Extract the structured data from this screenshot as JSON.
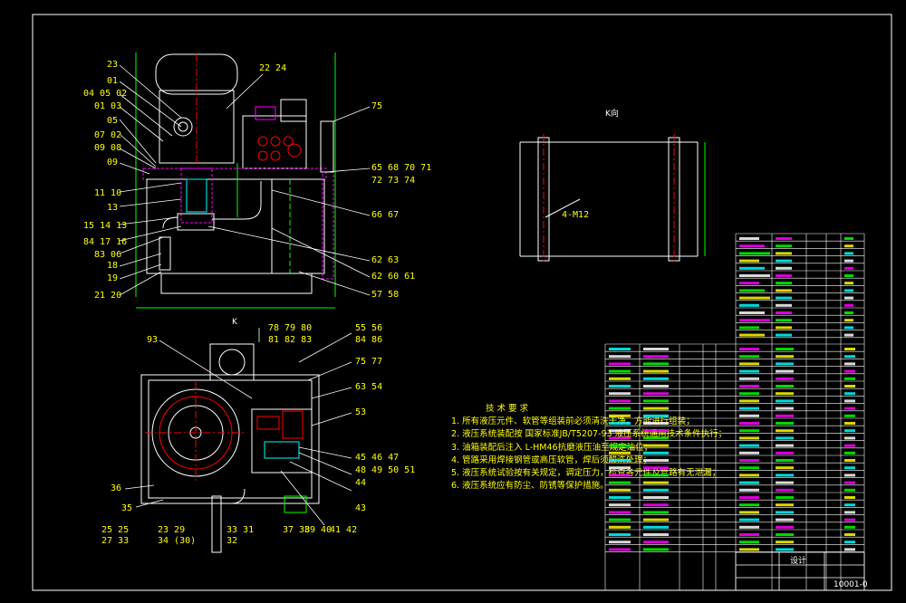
{
  "drawing": {
    "k_label": "K",
    "k_view_title": "K向",
    "bolt_callout": "4-M12",
    "sheet_title": "设计",
    "sheet_id": "10001-0"
  },
  "callouts": {
    "left_top": [
      "23",
      "01",
      "04 05 02",
      "01 03",
      "05",
      "07 02",
      "09 08",
      "09",
      "11 10",
      "13",
      "15 14 13",
      "84 17 16",
      "83 06",
      "18",
      "19",
      "21 20"
    ],
    "right_top": [
      "22 24",
      "75",
      "65 68 70 71",
      "72 73 74",
      "66 67",
      "62 63",
      "62 60 61",
      "57 58"
    ],
    "bottom_left": [
      "93",
      "36",
      "35",
      "25 25",
      "27 33",
      "23 29",
      "34 (30)",
      "33 31",
      "32"
    ],
    "bottom_top": [
      "78 79 80",
      "81 82 83",
      "55 56",
      "84 86",
      "75 77",
      "63 54",
      "53",
      "45 46 47",
      "48 49 50 51",
      "44",
      "43",
      "37 38",
      "39 40",
      "41 42"
    ]
  },
  "tech_req": {
    "title": "技 术 要 求",
    "lines": [
      "1. 所有液压元件、软管等组装前必须清洗干净，方能进行组装；",
      "2. 液压系统装配按  国家标准JB/T5207-93 液压系统通用技术条件执行；",
      "3. 油箱装配后注入  L-HM46抗磨液压油至规定油位；",
      "4. 管路采用焊接钢管或高压软管，焊后须酸洗处理；",
      "5. 液压系统试验按有关规定，调定压力，检查各元件及管路有无泄漏；",
      "6. 液压系统应有防尘、防锈等保护措施。"
    ]
  }
}
